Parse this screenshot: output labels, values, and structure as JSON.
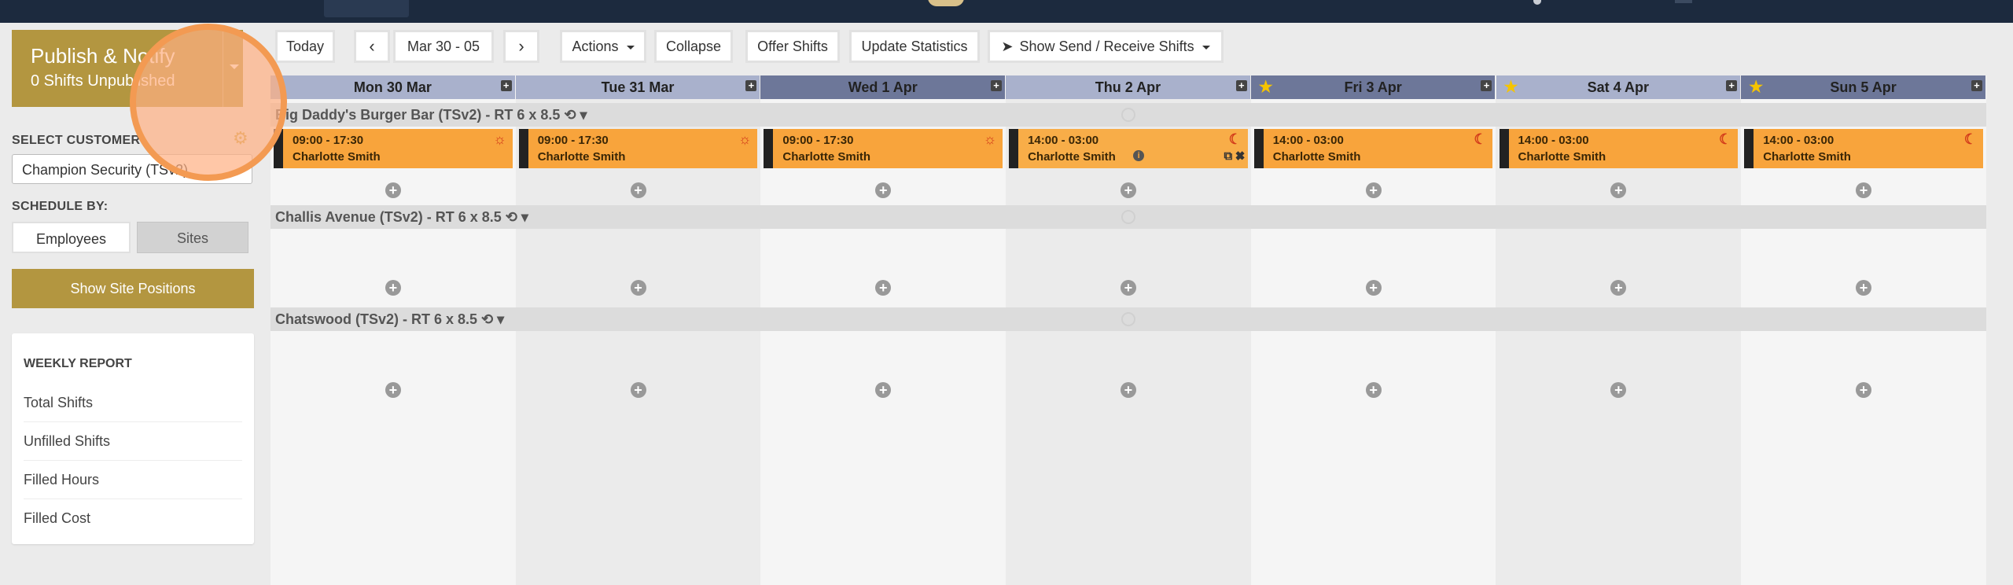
{
  "sidebar": {
    "publish_title": "Publish & Notify",
    "publish_sub": "0 Shifts Unpublished",
    "select_customer_label": "SELECT CUSTOMER",
    "customer_value": "Champion Security (TSv2)",
    "schedule_by_label": "SCHEDULE BY:",
    "toggle_employees": "Employees",
    "toggle_sites": "Sites",
    "show_positions": "Show Site Positions",
    "report_title": "WEEKLY REPORT",
    "report_items": [
      "Total Shifts",
      "Unfilled Shifts",
      "Filled Hours",
      "Filled Cost"
    ]
  },
  "toolbar": {
    "today": "Today",
    "date_range": "Mar 30 - 05",
    "actions": "Actions",
    "collapse": "Collapse",
    "offer": "Offer Shifts",
    "update_stats": "Update Statistics",
    "send_receive": "Show Send / Receive Shifts"
  },
  "days": [
    {
      "label": "Mon 30 Mar",
      "bg": "#a9b1cc",
      "star": false
    },
    {
      "label": "Tue 31 Mar",
      "bg": "#a9b1cc",
      "star": false
    },
    {
      "label": "Wed 1 Apr",
      "bg": "#6d7799",
      "star": false
    },
    {
      "label": "Thu 2 Apr",
      "bg": "#a9b1cc",
      "star": false
    },
    {
      "label": "Fri 3 Apr",
      "bg": "#6d7799",
      "star": true
    },
    {
      "label": "Sat 4 Apr",
      "bg": "#a9b1cc",
      "star": true
    },
    {
      "label": "Sun 5 Apr",
      "bg": "#6d7799",
      "star": true
    }
  ],
  "sites": [
    "Big Daddy's Burger Bar (TSv2) - RT 6 x 8.5",
    "Challis Avenue (TSv2) - RT 6 x 8.5",
    "Chatswood (TSv2) - RT 6 x 8.5"
  ],
  "shifts": [
    {
      "time": "09:00 - 17:30",
      "who": "Charlotte Smith",
      "icon": "sun-icon"
    },
    {
      "time": "09:00 - 17:30",
      "who": "Charlotte Smith",
      "icon": "sun-icon"
    },
    {
      "time": "09:00 - 17:30",
      "who": "Charlotte Smith",
      "icon": "sun-icon"
    },
    {
      "time": "14:00 - 03:00",
      "who": "Charlotte Smith",
      "icon": "moon-icon"
    },
    {
      "time": "14:00 - 03:00",
      "who": "Charlotte Smith",
      "icon": "moon-icon"
    },
    {
      "time": "14:00 - 03:00",
      "who": "Charlotte Smith",
      "icon": "moon-icon"
    },
    {
      "time": "14:00 - 03:00",
      "who": "Charlotte Smith",
      "icon": "moon-icon"
    }
  ],
  "colors": {
    "accent": "#b39640",
    "shift": "#f8a43c",
    "topbar": "#1c2a3e",
    "highlight": "#f39a52"
  }
}
